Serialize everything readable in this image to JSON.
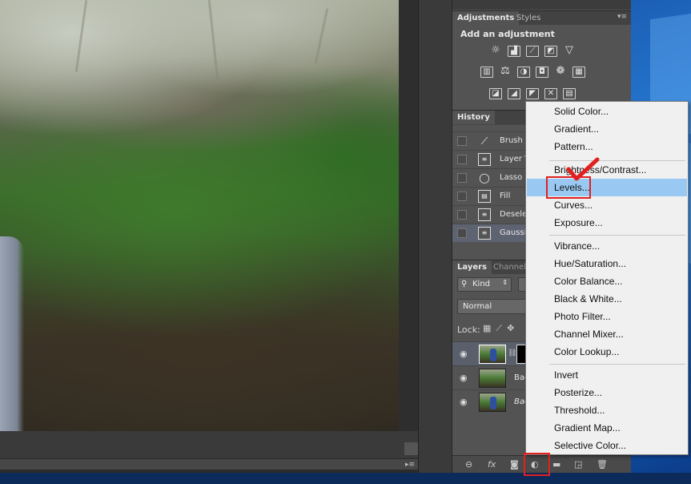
{
  "adjustments_panel": {
    "tabs": [
      "Adjustments",
      "Styles"
    ],
    "title": "Add an adjustment",
    "icons_row1": [
      "brightness-contrast-icon",
      "levels-icon",
      "curves-icon",
      "exposure-icon"
    ],
    "icons_row2": [
      "vibrance-icon",
      "hue-saturation-icon",
      "color-balance-icon",
      "black-white-icon",
      "photo-filter-icon",
      "channel-mixer-icon"
    ],
    "icons_row3": [
      "invert-icon",
      "posterize-icon",
      "threshold-icon",
      "selective-color-icon",
      "gradient-map-icon"
    ]
  },
  "history_panel": {
    "tab": "History",
    "items": [
      {
        "label": "Brush T",
        "icon": "brush-icon"
      },
      {
        "label": "Layer V",
        "icon": "document-icon"
      },
      {
        "label": "Lasso",
        "icon": "lasso-icon"
      },
      {
        "label": "Fill",
        "icon": "fill-icon"
      },
      {
        "label": "Deselec",
        "icon": "document-icon"
      },
      {
        "label": "Gaussia",
        "icon": "document-icon"
      }
    ]
  },
  "layers_panel": {
    "tabs": [
      "Layers",
      "Channels"
    ],
    "filter_kind": "Kind",
    "blend_mode": "Normal",
    "lock_label": "Lock:",
    "layers": [
      {
        "name": ""
      },
      {
        "name": "Bac"
      },
      {
        "name": "Bac"
      }
    ]
  },
  "adjustment_menu": {
    "group1": [
      "Solid Color...",
      "Gradient...",
      "Pattern..."
    ],
    "group2": [
      "Brightness/Contrast...",
      "Levels...",
      "Curves...",
      "Exposure..."
    ],
    "group3": [
      "Vibrance...",
      "Hue/Saturation...",
      "Color Balance...",
      "Black & White...",
      "Photo Filter...",
      "Channel Mixer...",
      "Color Lookup..."
    ],
    "group4": [
      "Invert",
      "Posterize...",
      "Threshold...",
      "Gradient Map...",
      "Selective Color..."
    ],
    "highlighted": "Levels..."
  },
  "colors": {
    "highlight": "#99c9f2",
    "annotation_red": "#e32020",
    "panel_bg": "#535353"
  }
}
